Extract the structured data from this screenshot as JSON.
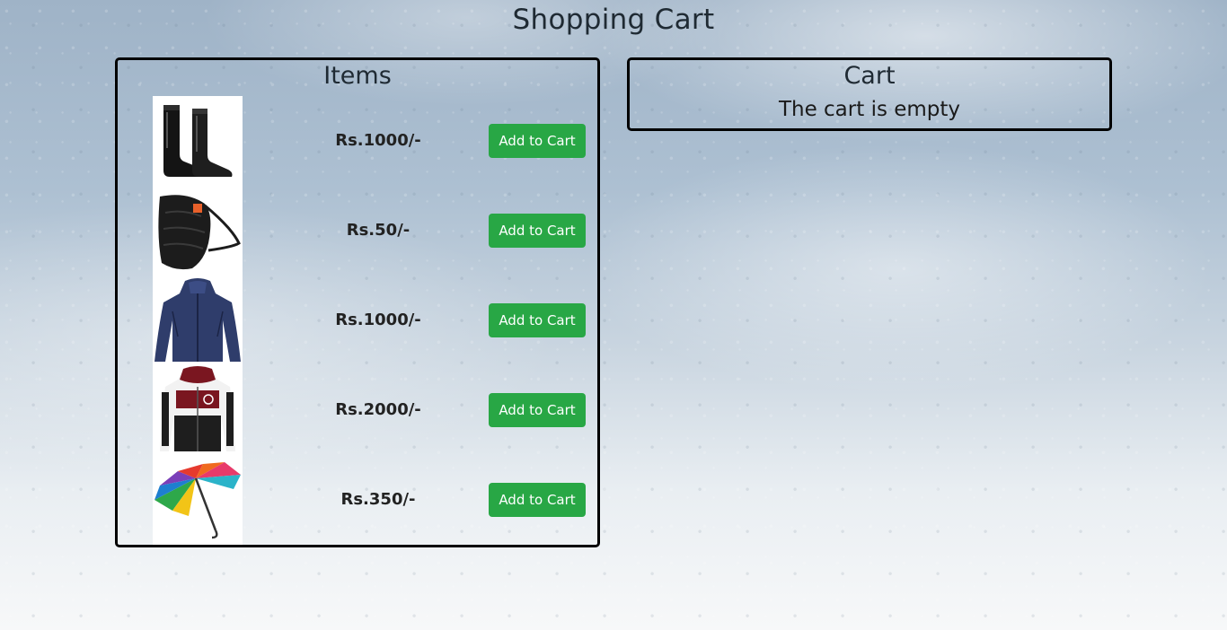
{
  "page": {
    "title": "Shopping Cart"
  },
  "items_panel": {
    "title": "Items",
    "items": [
      {
        "image": "rain-boots-image",
        "price": "Rs.1000/-",
        "button_label": "Add to Cart"
      },
      {
        "image": "face-mask-image",
        "price": "Rs.50/-",
        "button_label": "Add to Cart"
      },
      {
        "image": "rain-jacket-image",
        "price": "Rs.1000/-",
        "button_label": "Add to Cart"
      },
      {
        "image": "hooded-jacket-image",
        "price": "Rs.2000/-",
        "button_label": "Add to Cart"
      },
      {
        "image": "umbrella-image",
        "price": "Rs.350/-",
        "button_label": "Add to Cart"
      }
    ]
  },
  "cart_panel": {
    "title": "Cart",
    "empty_message": "The cart is empty"
  },
  "colors": {
    "button": "#28a745",
    "button_text": "#ffffff",
    "border": "#000000"
  }
}
